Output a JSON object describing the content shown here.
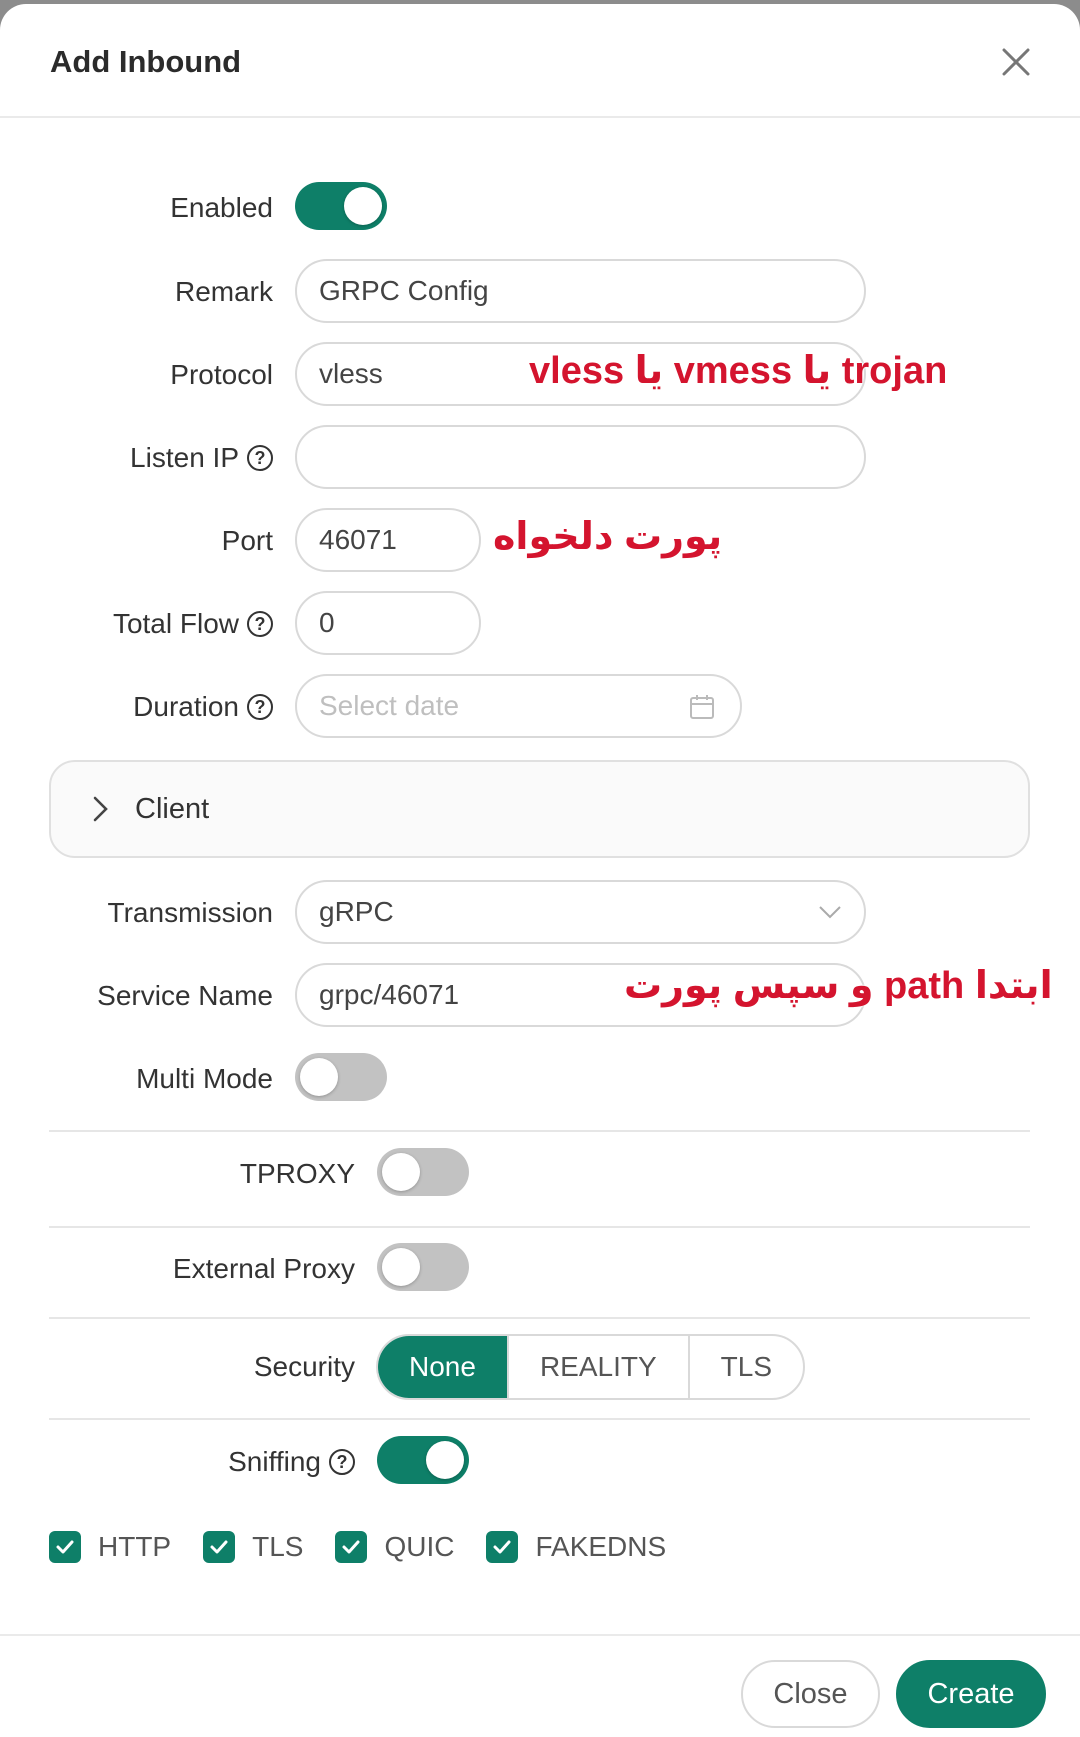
{
  "dialog": {
    "title": "Add Inbound"
  },
  "form": {
    "enabled_label": "Enabled",
    "remark_label": "Remark",
    "remark_value": "GRPC Config",
    "protocol_label": "Protocol",
    "protocol_value": "vless",
    "listen_ip_label": "Listen IP",
    "listen_ip_value": "",
    "port_label": "Port",
    "port_value": "46071",
    "total_flow_label": "Total Flow",
    "total_flow_value": "0",
    "duration_label": "Duration",
    "duration_placeholder": "Select date",
    "client_label": "Client",
    "transmission_label": "Transmission",
    "transmission_value": "gRPC",
    "service_name_label": "Service Name",
    "service_name_value": "grpc/46071",
    "multi_mode_label": "Multi Mode",
    "tproxy_label": "TPROXY",
    "external_proxy_label": "External Proxy",
    "security_label": "Security",
    "security_options": [
      "None",
      "REALITY",
      "TLS"
    ],
    "sniffing_label": "Sniffing",
    "sniffing_options": [
      "HTTP",
      "TLS",
      "QUIC",
      "FAKEDNS"
    ]
  },
  "toggles": {
    "enabled": true,
    "multi_mode": false,
    "tproxy": false,
    "external_proxy": false,
    "sniffing": true
  },
  "annotations": {
    "protocol_note": "trojan یا vmess یا vless",
    "port_note": "پورت دلخواه",
    "service_note": "ابتدا path و سپس پورت"
  },
  "footer": {
    "close_label": "Close",
    "create_label": "Create"
  },
  "colors": {
    "accent": "#0e7f68",
    "annotation": "#d4142e"
  },
  "icons": {
    "close": "close-icon",
    "help": "question-circle-icon",
    "calendar": "calendar-icon",
    "expand": "chevron-right-icon",
    "dropdown": "chevron-down-icon",
    "check": "check-icon"
  }
}
